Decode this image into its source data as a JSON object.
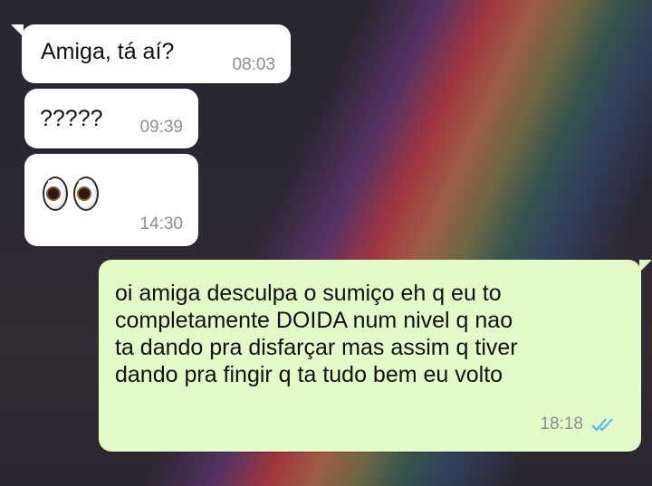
{
  "chat": {
    "messages": [
      {
        "direction": "incoming",
        "text": "Amiga, tá aí?",
        "time": "08:03"
      },
      {
        "direction": "incoming",
        "text": "?????",
        "time": "09:39"
      },
      {
        "direction": "incoming",
        "emoji": "eyes",
        "time": "14:30"
      },
      {
        "direction": "outgoing",
        "lines": [
          "oi amiga desculpa o sumiço eh q eu to",
          "completamente DOIDA num nivel q nao",
          "ta dando pra disfarçar mas assim q tiver",
          "dando pra fingir q ta tudo bem eu volto"
        ],
        "time": "18:18",
        "status": "read-double-check",
        "status_color": "#4fb6ec"
      }
    ]
  },
  "colors": {
    "incoming_bubble": "#ffffff",
    "outgoing_bubble": "#e2fbc9",
    "timestamp": "#8a8f93"
  }
}
